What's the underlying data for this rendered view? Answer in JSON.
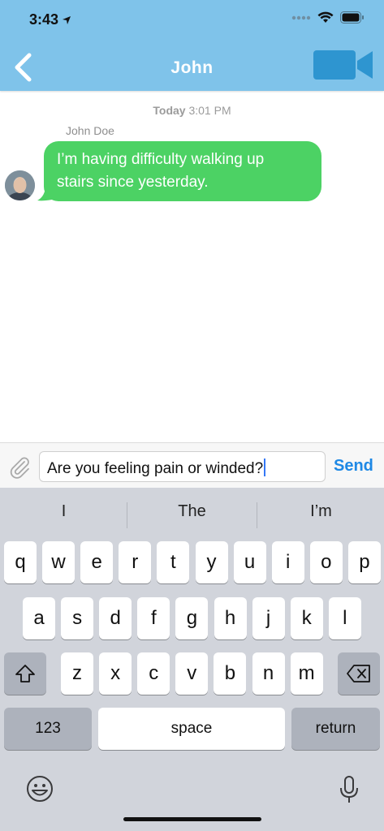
{
  "status_bar": {
    "time": "3:43"
  },
  "header": {
    "title": "John"
  },
  "conversation": {
    "timestamp_day": "Today",
    "timestamp_time": "3:01 PM",
    "sender_name": "John Doe",
    "message_line1": "I’m having difficulty walking up",
    "message_line2": "stairs since yesterday."
  },
  "composer": {
    "input_value": "Are you feeling pain or winded?",
    "send_label": "Send"
  },
  "keyboard": {
    "suggestions": [
      "I",
      "The",
      "I’m"
    ],
    "row1": [
      "q",
      "w",
      "e",
      "r",
      "t",
      "y",
      "u",
      "i",
      "o",
      "p"
    ],
    "row2": [
      "a",
      "s",
      "d",
      "f",
      "g",
      "h",
      "j",
      "k",
      "l"
    ],
    "row3": [
      "z",
      "x",
      "c",
      "v",
      "b",
      "n",
      "m"
    ],
    "numbers_label": "123",
    "space_label": "space",
    "return_label": "return"
  },
  "colors": {
    "header": "#7fc3ea",
    "bubble": "#4cd264",
    "send": "#1e88e5"
  }
}
